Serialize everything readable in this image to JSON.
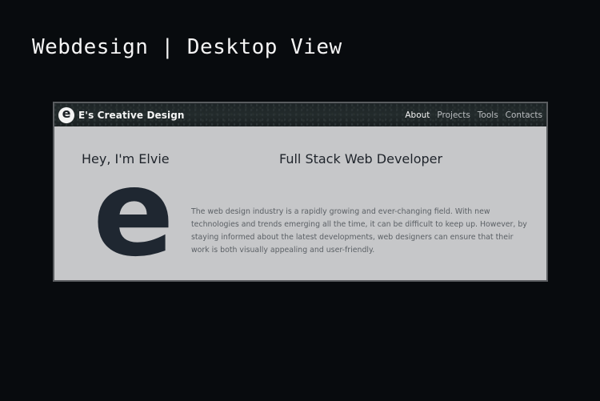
{
  "page": {
    "heading": "Webdesign | Desktop View"
  },
  "site": {
    "logo_letter": "e",
    "brand": "E's Creative Design",
    "nav": [
      {
        "label": "About",
        "active": true
      },
      {
        "label": "Projects",
        "active": false
      },
      {
        "label": "Tools",
        "active": false
      },
      {
        "label": "Contacts",
        "active": false
      }
    ]
  },
  "hero": {
    "greeting": "Hey, I'm Elvie",
    "role": "Full Stack Web Developer",
    "big_letter": "e",
    "paragraph": "The web design industry is a rapidly growing and ever-changing field. With new technologies and trends emerging all the time, it can be difficult to keep up. However, by staying informed about the latest developments, web designers can ensure that their work is both visually appealing and user-friendly."
  },
  "colors": {
    "page_background": "#080b0e",
    "site_background": "#c6c7c9",
    "navbar": "#1d2426",
    "text_dark": "#1f242b"
  }
}
